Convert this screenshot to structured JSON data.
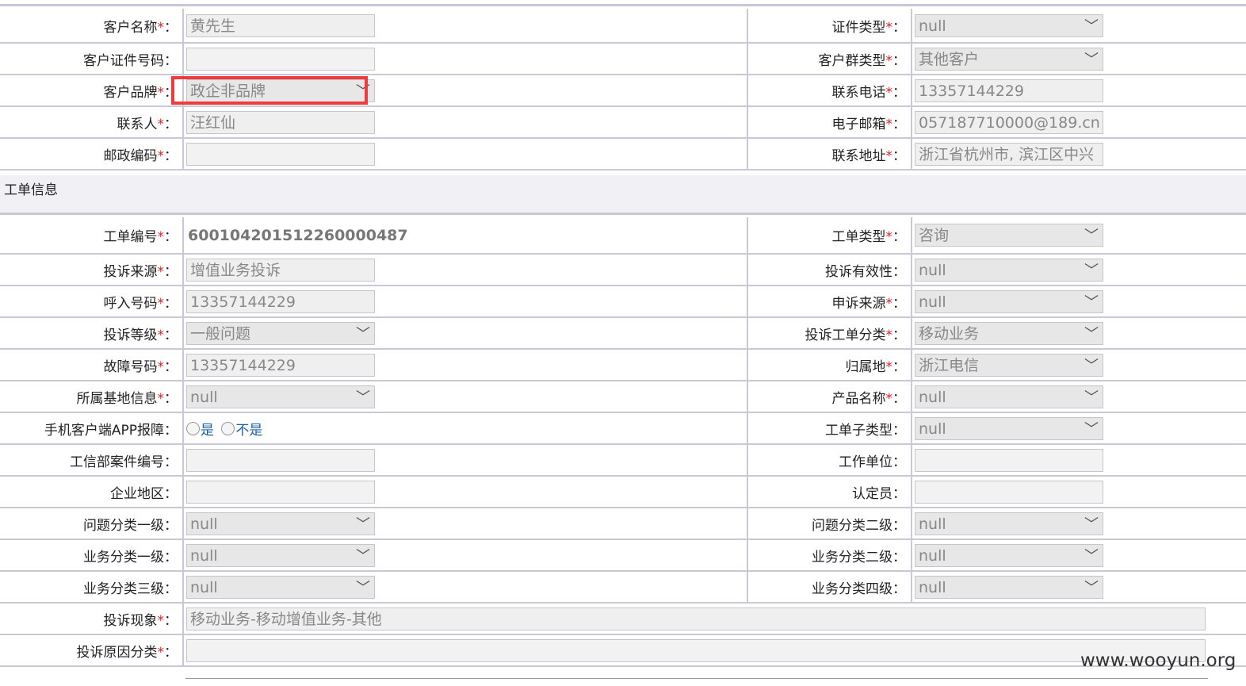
{
  "customer": {
    "name_label": "客户名称",
    "name_value": "黄先生",
    "id_type_label": "证件类型",
    "id_type_value": "null",
    "id_no_label": "客户证件号码",
    "id_no_value": "",
    "group_type_label": "客户群类型",
    "group_type_value": "其他客户",
    "brand_label": "客户品牌",
    "brand_value": "政企非品牌",
    "phone_label": "联系电话",
    "phone_value": "13357144229",
    "contact_label": "联系人",
    "contact_value": "汪红仙",
    "email_label": "电子邮箱",
    "email_value": "057187710000@189.cn",
    "postcode_label": "邮政编码",
    "postcode_value": "",
    "address_label": "联系地址",
    "address_value": "浙江省杭州市, 滨江区中兴"
  },
  "section": {
    "title": "工单信息"
  },
  "ticket": {
    "number_label": "工单编号",
    "number_value": "600104201512260000487",
    "type_label": "工单类型",
    "type_value": "咨询",
    "source_label": "投诉来源",
    "source_value": "增值业务投诉",
    "validity_label": "投诉有效性",
    "validity_value": "null",
    "caller_label": "呼入号码",
    "caller_value": "13357144229",
    "appeal_source_label": "申诉来源",
    "appeal_source_value": "null",
    "level_label": "投诉等级",
    "level_value": "一般问题",
    "category_label": "投诉工单分类",
    "category_value": "移动业务",
    "fault_label": "故障号码",
    "fault_value": "13357144229",
    "region_label": "归属地",
    "region_value": "浙江电信",
    "base_label": "所属基地信息",
    "base_value": "null",
    "product_label": "产品名称",
    "product_value": "null",
    "app_label": "手机客户端APP报障",
    "app_yes": "是",
    "app_no": "不是",
    "subtype_label": "工单子类型",
    "subtype_value": "null",
    "miit_label": "工信部案件编号",
    "miit_value": "",
    "org_label": "工作单位",
    "org_value": "",
    "ent_region_label": "企业地区",
    "ent_region_value": "",
    "assessor_label": "认定员",
    "assessor_value": "",
    "q1_label": "问题分类一级",
    "q1_value": "null",
    "q2_label": "问题分类二级",
    "q2_value": "null",
    "b1_label": "业务分类一级",
    "b1_value": "null",
    "b2_label": "业务分类二级",
    "b2_value": "null",
    "b3_label": "业务分类三级",
    "b3_value": "null",
    "b4_label": "业务分类四级",
    "b4_value": "null",
    "phenomenon_label": "投诉现象",
    "phenomenon_value": "移动业务-移动增值业务-其他",
    "reason_label": "投诉原因分类",
    "reason_value": ""
  },
  "colon": "：",
  "required_mark": "*",
  "icons": {
    "dropdown": "chevron-down-icon"
  },
  "watermark": "www.wooyun.org",
  "colors": {
    "required": "#e02020",
    "highlight": "#ef3b3b",
    "link": "#1c5fa6",
    "border": "#c8c8d8"
  }
}
